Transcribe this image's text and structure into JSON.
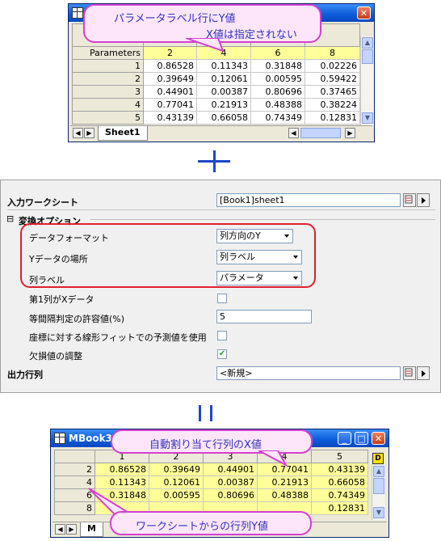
{
  "top_window": {
    "callout_line1": "パラメータラベル行にY値",
    "callout_line2": "X値は指定されない",
    "param_label": "Parameters",
    "param_values": [
      "2",
      "4",
      "6",
      "8"
    ],
    "rows": [
      {
        "n": "1",
        "v": [
          "0.86528",
          "0.11343",
          "0.31848",
          "0.02226"
        ]
      },
      {
        "n": "2",
        "v": [
          "0.39649",
          "0.12061",
          "0.00595",
          "0.59422"
        ]
      },
      {
        "n": "3",
        "v": [
          "0.44901",
          "0.00387",
          "0.80696",
          "0.37465"
        ]
      },
      {
        "n": "4",
        "v": [
          "0.77041",
          "0.21913",
          "0.48388",
          "0.38224"
        ]
      },
      {
        "n": "5",
        "v": [
          "0.43139",
          "0.66058",
          "0.74349",
          "0.12831"
        ]
      }
    ],
    "sheet_tab": "Sheet1"
  },
  "dialog": {
    "input_label": "入力ワークシート",
    "input_value": "[Book1]sheet1",
    "group_label": "変換オプション",
    "data_format_label": "データフォーマット",
    "data_format_value": "列方向のY",
    "y_location_label": "Yデータの場所",
    "y_location_value": "列ラベル",
    "col_label_label": "列ラベル",
    "col_label_value": "パラメータ",
    "first_col_label": "第1列がXデータ",
    "tolerance_label": "等間隔判定の許容値(%)",
    "tolerance_value": "5",
    "linear_fit_label": "座標に対する線形フィットでの予測値を使用",
    "missing_label": "欠損値の調整",
    "output_label": "出力行列",
    "output_value": "<新規>",
    "collapse_symbol": "⊟",
    "first_col_checked": false,
    "linear_fit_checked": false,
    "missing_checked": true,
    "highlight_color": "#e02030"
  },
  "operators": {
    "plus": "＋",
    "equals": "＝"
  },
  "bottom_window": {
    "title": "MBook3",
    "callout_top": "自動割り当て行列のX値",
    "callout_bottom": "ワークシートからの行列Y値",
    "col_headers": [
      "1",
      "2",
      "3",
      "4",
      "5"
    ],
    "rows": [
      {
        "n": "2",
        "v": [
          "0.86528",
          "0.39649",
          "0.44901",
          "0.77041",
          "0.43139"
        ]
      },
      {
        "n": "4",
        "v": [
          "0.11343",
          "0.12061",
          "0.00387",
          "0.21913",
          "0.66058"
        ]
      },
      {
        "n": "6",
        "v": [
          "0.31848",
          "0.00595",
          "0.80696",
          "0.48388",
          "0.74349"
        ]
      },
      {
        "n": "8",
        "v": [
          "",
          "",
          "",
          "",
          "0.12831"
        ]
      }
    ],
    "sheet_tab": "M",
    "d_button": "D",
    "highlight_color": "#ffff99"
  }
}
